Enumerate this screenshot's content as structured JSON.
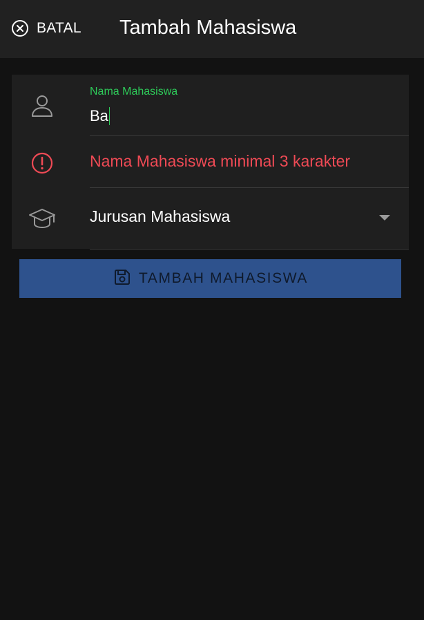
{
  "colors": {
    "background": "#121212",
    "appbar": "#212121",
    "card": "#1f1f1f",
    "accent_green": "#2ecc5a",
    "error_red": "#ef4a55",
    "button_blue": "#2e528d",
    "icon_gray": "#9a9a9a"
  },
  "appbar": {
    "cancel_icon": "close-circle-icon",
    "cancel_label": "BATAL",
    "title": "Tambah Mahasiswa"
  },
  "form": {
    "name_field": {
      "icon": "person-icon",
      "label": "Nama Mahasiswa",
      "value": "Ba"
    },
    "error": {
      "icon": "alert-circle-icon",
      "message": "Nama Mahasiswa minimal 3 karakter"
    },
    "major_select": {
      "icon": "graduation-cap-icon",
      "selected": "Jurusan Mahasiswa"
    },
    "submit": {
      "icon": "floppy-disk-icon",
      "label": "TAMBAH MAHASISWA"
    }
  }
}
